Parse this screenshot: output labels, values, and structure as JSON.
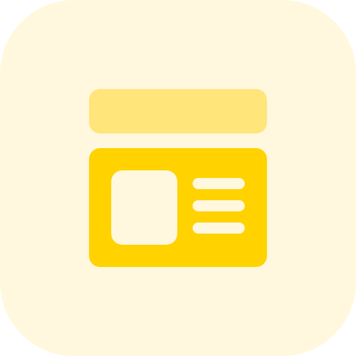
{
  "icon": {
    "name": "web-page-layout-icon",
    "colors": {
      "tile_background": "#fff8de",
      "header_bar": "#ffe57a",
      "content_card": "#ffd200",
      "content_inner": "#fff8de"
    }
  }
}
